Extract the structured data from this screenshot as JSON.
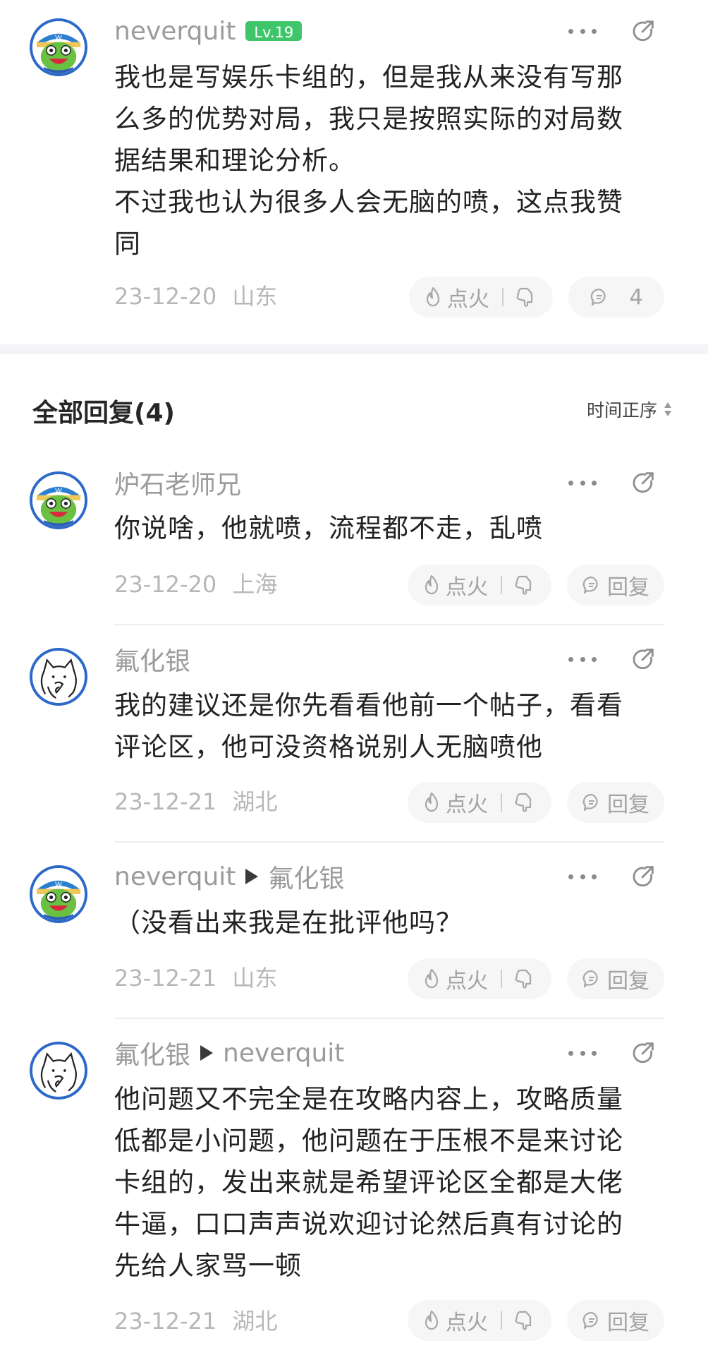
{
  "main_comment": {
    "username": "neverquit",
    "level": "Lv.19",
    "lines": [
      "我也是写娱乐卡组的，但是我从来没有写那",
      "么多的优势对局，我只是按照实际的对局数",
      "据结果和理论分析。",
      "不过我也认为很多人会无脑的喷，这点我赞",
      "同"
    ],
    "date": "23-12-20",
    "location": "山东",
    "fire_label": "点火",
    "reply_count": "4"
  },
  "replies_header": {
    "title": "全部回复(4)",
    "sort_label": "时间正序"
  },
  "replies": [
    {
      "username": "炉石老师兄",
      "reply_to": "",
      "lines": [
        "你说啥，他就喷，流程都不走，乱喷"
      ],
      "date": "23-12-20",
      "location": "上海",
      "fire_label": "点火",
      "reply_label": "回复"
    },
    {
      "username": "氟化银",
      "reply_to": "",
      "lines": [
        "我的建议还是你先看看他前一个帖子，看看",
        "评论区，他可没资格说别人无脑喷他"
      ],
      "date": "23-12-21",
      "location": "湖北",
      "fire_label": "点火",
      "reply_label": "回复"
    },
    {
      "username": "neverquit",
      "reply_to": "氟化银",
      "lines": [
        "（没看出来我是在批评他吗？"
      ],
      "date": "23-12-21",
      "location": "山东",
      "fire_label": "点火",
      "reply_label": "回复"
    },
    {
      "username": "氟化银",
      "reply_to": "neverquit",
      "lines": [
        "他问题又不完全是在攻略内容上，攻略质量",
        "低都是小问题，他问题在于压根不是来讨论",
        "卡组的，发出来就是希望评论区全都是大佬",
        "牛逼，口口声声说欢迎讨论然后真有讨论的",
        "先给人家骂一顿"
      ],
      "date": "23-12-21",
      "location": "湖北",
      "fire_label": "点火",
      "reply_label": "回复"
    }
  ],
  "icons": {
    "more": "more-dots-icon",
    "share": "share-external-icon",
    "fire": "flame-icon",
    "unfire": "thumbs-down-hand-icon",
    "comment": "speech-bubble-icon",
    "sort": "sort-arrows-icon"
  },
  "colors": {
    "level_badge": "#3fc66a",
    "avatar_ring": "#2d69c9",
    "meta_text": "#b7b7b7",
    "pill_bg": "#f6f6f6"
  }
}
